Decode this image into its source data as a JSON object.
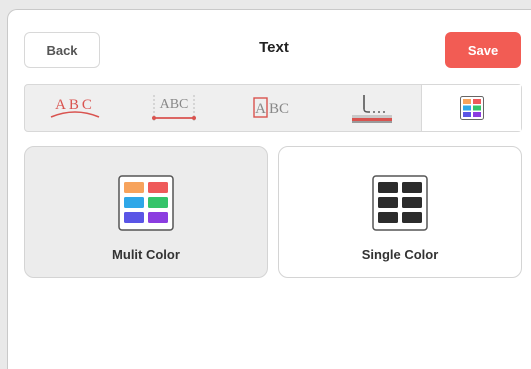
{
  "header": {
    "back_label": "Back",
    "title": "Text",
    "save_label": "Save"
  },
  "tabs": [
    {
      "name": "curved-text",
      "text": "ABC",
      "active": false
    },
    {
      "name": "text-width",
      "text": "ABC",
      "active": false
    },
    {
      "name": "text-box",
      "text_boxed": "A",
      "text_rest": "BC",
      "active": false
    },
    {
      "name": "text-layer",
      "active": false
    },
    {
      "name": "color-mode",
      "active": true
    }
  ],
  "color_options": [
    {
      "label": "Mulit Color",
      "selected": true
    },
    {
      "label": "Single Color",
      "selected": false
    }
  ],
  "colors": {
    "accent": "#f25c54",
    "multi": [
      "#f7a35c",
      "#ef5a5a",
      "#2ea7e8",
      "#35c46a",
      "#5a55e6",
      "#8b3de0"
    ],
    "single": "#2b2b2b"
  }
}
